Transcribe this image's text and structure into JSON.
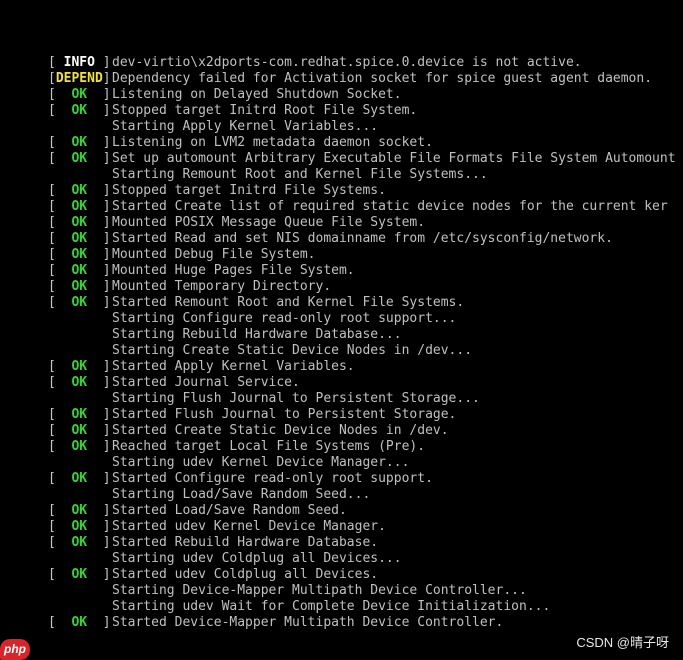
{
  "console": {
    "lines": [
      {
        "status": "INFO",
        "message": "dev-virtio\\x2dports-com.redhat.spice.0.device is not active."
      },
      {
        "status": "DEPEND",
        "message": "Dependency failed for Activation socket for spice guest agent daemon."
      },
      {
        "status": "OK",
        "message": "Listening on Delayed Shutdown Socket."
      },
      {
        "status": "OK",
        "message": "Stopped target Initrd Root File System."
      },
      {
        "status": "",
        "message": "Starting Apply Kernel Variables..."
      },
      {
        "status": "OK",
        "message": "Listening on LVM2 metadata daemon socket."
      },
      {
        "status": "OK",
        "message": "Set up automount Arbitrary Executable File Formats File System Automount"
      },
      {
        "status": "",
        "message": "Starting Remount Root and Kernel File Systems..."
      },
      {
        "status": "OK",
        "message": "Stopped target Initrd File Systems."
      },
      {
        "status": "OK",
        "message": "Started Create list of required static device nodes for the current ker"
      },
      {
        "status": "OK",
        "message": "Mounted POSIX Message Queue File System."
      },
      {
        "status": "OK",
        "message": "Started Read and set NIS domainname from /etc/sysconfig/network."
      },
      {
        "status": "OK",
        "message": "Mounted Debug File System."
      },
      {
        "status": "OK",
        "message": "Mounted Huge Pages File System."
      },
      {
        "status": "OK",
        "message": "Mounted Temporary Directory."
      },
      {
        "status": "OK",
        "message": "Started Remount Root and Kernel File Systems."
      },
      {
        "status": "",
        "message": "Starting Configure read-only root support..."
      },
      {
        "status": "",
        "message": "Starting Rebuild Hardware Database..."
      },
      {
        "status": "",
        "message": "Starting Create Static Device Nodes in /dev..."
      },
      {
        "status": "OK",
        "message": "Started Apply Kernel Variables."
      },
      {
        "status": "OK",
        "message": "Started Journal Service."
      },
      {
        "status": "",
        "message": "Starting Flush Journal to Persistent Storage..."
      },
      {
        "status": "OK",
        "message": "Started Flush Journal to Persistent Storage."
      },
      {
        "status": "OK",
        "message": "Started Create Static Device Nodes in /dev."
      },
      {
        "status": "OK",
        "message": "Reached target Local File Systems (Pre)."
      },
      {
        "status": "",
        "message": "Starting udev Kernel Device Manager..."
      },
      {
        "status": "OK",
        "message": "Started Configure read-only root support."
      },
      {
        "status": "",
        "message": "Starting Load/Save Random Seed..."
      },
      {
        "status": "OK",
        "message": "Started Load/Save Random Seed."
      },
      {
        "status": "OK",
        "message": "Started udev Kernel Device Manager."
      },
      {
        "status": "OK",
        "message": "Started Rebuild Hardware Database."
      },
      {
        "status": "",
        "message": "Starting udev Coldplug all Devices..."
      },
      {
        "status": "OK",
        "message": "Started udev Coldplug all Devices."
      },
      {
        "status": "",
        "message": "Starting Device-Mapper Multipath Device Controller..."
      },
      {
        "status": "",
        "message": "Starting udev Wait for Complete Device Initialization..."
      },
      {
        "status": "OK",
        "message": "Started Device-Mapper Multipath Device Controller."
      }
    ]
  },
  "watermarks": {
    "left_logo": "php",
    "right_text": "CSDN @晴子呀"
  },
  "colors": {
    "background": "#000000",
    "ok": "#33d633",
    "depend": "#f0e040",
    "info": "#ffffff",
    "text": "#c0c0c0"
  }
}
